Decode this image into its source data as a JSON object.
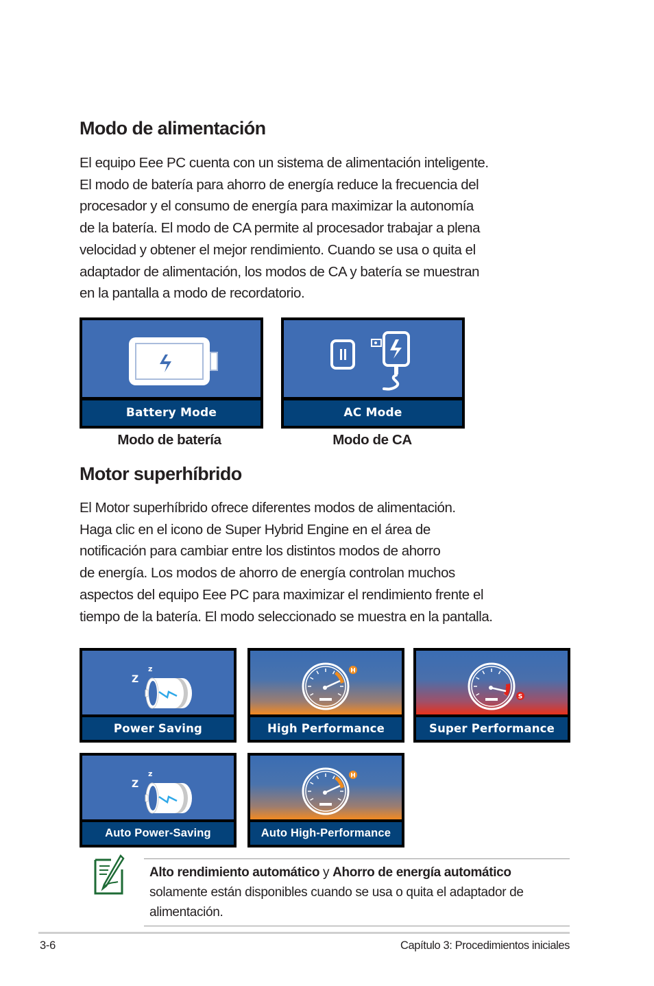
{
  "section1": {
    "title": "Modo de alimentación",
    "paragraph_lines": [
      "El equipo Eee PC cuenta con un sistema de alimentación inteligente.",
      "El modo de batería para ahorro de energía reduce la frecuencia del",
      "procesador y el consumo de energía para maximizar la autonomía",
      "de la batería. El modo de CA permite al procesador trabajar a plena",
      "velocidad y obtener el mejor rendimiento. Cuando se usa o quita el",
      "adaptador de alimentación, los modos de CA y batería se muestran",
      "en la pantalla a modo de recordatorio."
    ],
    "tiles": [
      {
        "label": "Battery Mode",
        "caption": "Modo de batería",
        "icon": "battery-icon"
      },
      {
        "label": "AC Mode",
        "caption": "Modo de CA",
        "icon": "ac-adapter-icon"
      }
    ]
  },
  "section2": {
    "title": "Motor superhíbrido",
    "paragraph_lines": [
      "El Motor superhíbrido ofrece diferentes modos de alimentación.",
      "Haga clic en el icono de Super Hybrid Engine en el área de",
      "notificación para cambiar entre los distintos modos de ahorro",
      "de energía. Los modos de ahorro de energía controlan muchos",
      "aspectos del equipo Eee PC para maximizar el rendimiento frente el",
      "tiempo de la batería. El modo seleccionado se muestra en la pantalla."
    ],
    "tiles": [
      {
        "label": "Power Saving",
        "icon": "sleeping-battery-icon"
      },
      {
        "label": "High Performance",
        "icon": "speedometer-high-icon",
        "badge": "H"
      },
      {
        "label": "Super Performance",
        "icon": "speedometer-super-icon",
        "badge": "S"
      },
      {
        "label": "Auto Power-Saving",
        "icon": "sleeping-battery-icon"
      },
      {
        "label": "Auto High-Performance",
        "icon": "speedometer-high-icon",
        "badge": "H"
      }
    ]
  },
  "note": {
    "icon": "note-pencil-icon",
    "bold1": "Alto rendimiento automático",
    "connector": " y ",
    "bold2": "Ahorro de energía automático",
    "rest": " solamente están disponibles cuando se usa o quita el adaptador de alimentación."
  },
  "footer": {
    "page_number": "3-6",
    "chapter": "Capítulo 3: Procedimientos iniciales"
  },
  "colors": {
    "tile_screen_blue": "#3f6db4",
    "tile_label_navy": "#04427a",
    "high_orange": "#f08c1e",
    "super_red": "#e0241c",
    "note_green": "#1e6b35"
  }
}
